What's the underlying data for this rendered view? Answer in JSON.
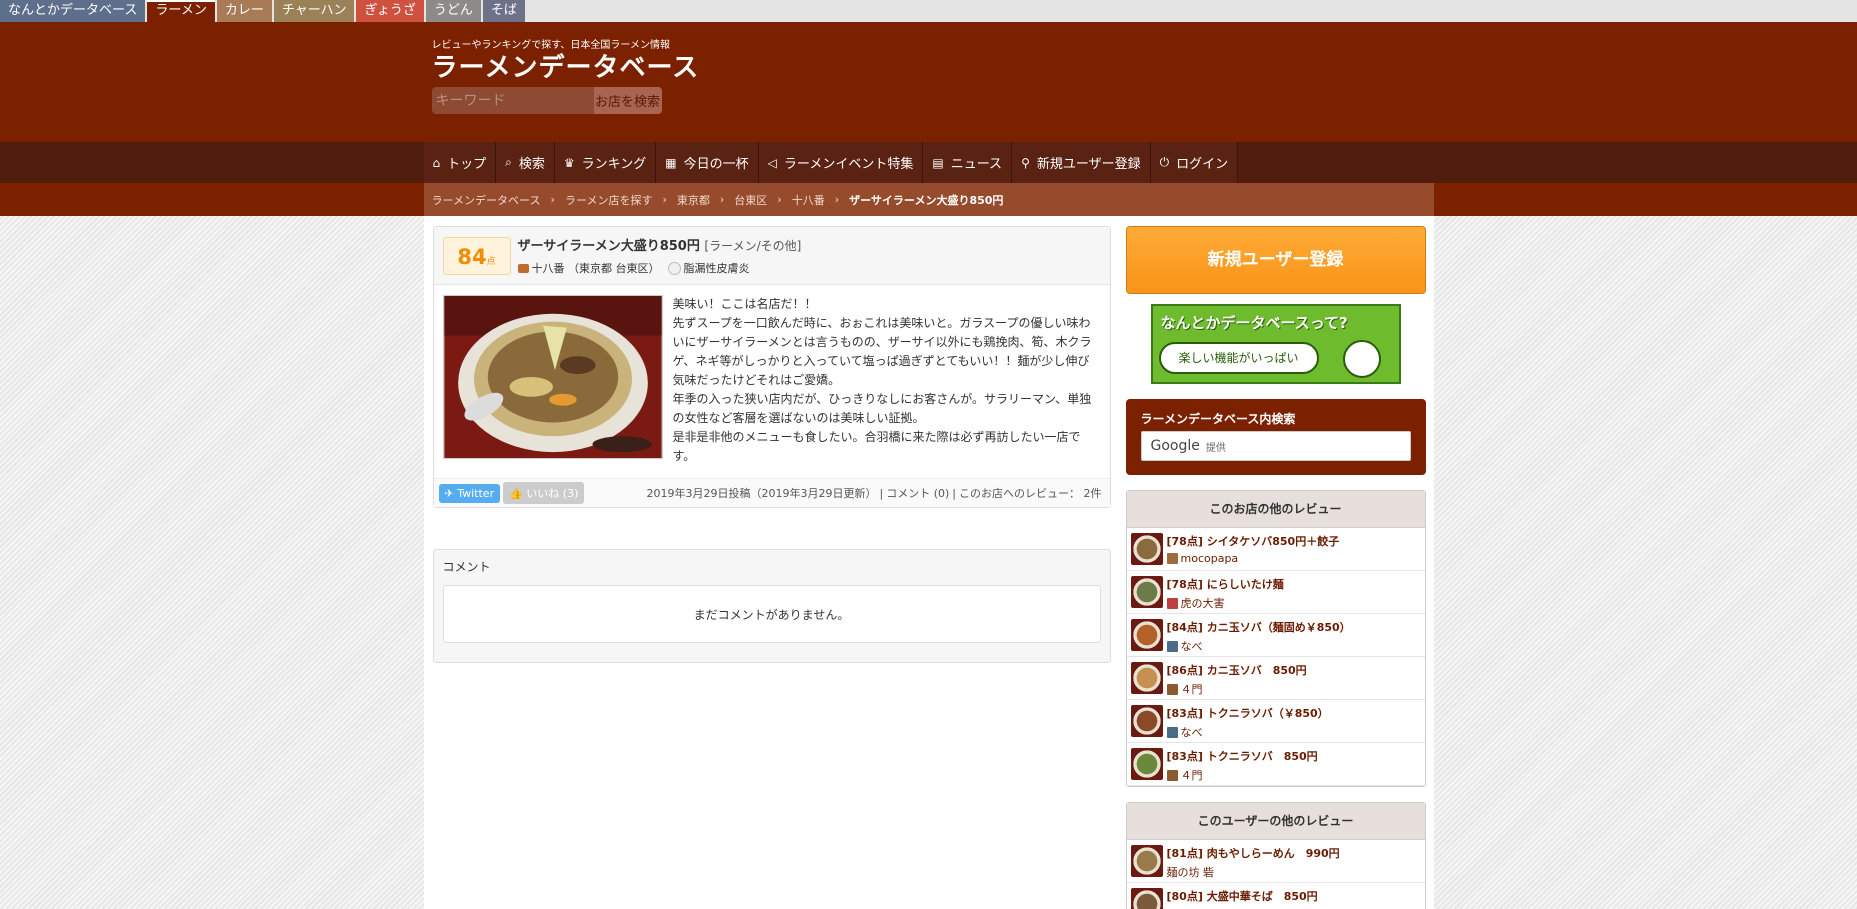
{
  "site_tabs": [
    {
      "label": "なんとかデータベース",
      "color": "#5e6f8c",
      "active": false
    },
    {
      "label": "ラーメン",
      "color": "#7b2100",
      "active": true
    },
    {
      "label": "カレー",
      "color": "#a87a56",
      "active": false
    },
    {
      "label": "チャーハン",
      "color": "#9a8158",
      "active": false
    },
    {
      "label": "ぎょうざ",
      "color": "#d0513f",
      "active": false
    },
    {
      "label": "うどん",
      "color": "#8e8a8a",
      "active": false
    },
    {
      "label": "そば",
      "color": "#6e7289",
      "active": false
    }
  ],
  "header": {
    "tagline": "レビューやランキングで探す、日本全国ラーメン情報",
    "logo": "ラーメンデータベース",
    "search_placeholder": "キーワード",
    "search_button": "お店を検索"
  },
  "nav": [
    {
      "icon": "home-icon",
      "glyph": "⌂",
      "label": "トップ"
    },
    {
      "icon": "search-icon",
      "glyph": "⌕",
      "label": "検索"
    },
    {
      "icon": "trophy-icon",
      "glyph": "♛",
      "label": "ランキング"
    },
    {
      "icon": "calendar-icon",
      "glyph": "▦",
      "label": "今日の一杯"
    },
    {
      "icon": "bullhorn-icon",
      "glyph": "◁",
      "label": "ラーメンイベント特集"
    },
    {
      "icon": "newspaper-icon",
      "glyph": "▤",
      "label": "ニュース"
    },
    {
      "icon": "user-plus-icon",
      "glyph": "⚲",
      "label": "新規ユーザー登録"
    },
    {
      "icon": "power-icon",
      "glyph": "⏻",
      "label": "ログイン"
    }
  ],
  "breadcrumb": {
    "items": [
      "ラーメンデータベース",
      "ラーメン店を探す",
      "東京都",
      "台東区",
      "十八番"
    ],
    "current": "ザーサイラーメン大盛り850円"
  },
  "review": {
    "score": "84",
    "score_unit": "点",
    "title": "ザーサイラーメン大盛り850円",
    "category": "[ラーメン/その他]",
    "shop": "十八番 （東京都 台東区）",
    "user": "脂漏性皮膚炎",
    "body": "美味い！ここは名店だ！！\n先ずスープを一口飲んだ時に、おぉこれは美味いと。ガラスープの優しい味わいにザーサイラーメンとは言うものの、ザーサイ以外にも鶏挽肉、筍、木クラゲ、ネギ等がしっかりと入っていて塩っぱ過ぎずとてもいい！！麺が少し伸び気味だったけどそれはご愛嬌。\n年季の入った狭い店内だが、ひっきりなしにお客さんが。サラリーマン、単独の女性など客層を選ばないのは美味しい証拠。\n是非是非他のメニューも食したい。合羽橋に来た際は必ず再訪したい一店です。",
    "twitter_label": "Twitter",
    "like_label": "いいね (3)",
    "posted": "2019年3月29日投稿（2019年3月29日更新）",
    "comment_count": "コメント (0)",
    "shop_reviews": "このお店へのレビュー： 2件"
  },
  "comments": {
    "title": "コメント",
    "empty": "まだコメントがありません。"
  },
  "sidebar": {
    "register_label": "新規ユーザー登録",
    "banner_title": "なんとかデータベースって?",
    "banner_bubble": "楽しい機能がいっぱい",
    "search_title": "ラーメンデータベース内検索",
    "google_logo": "Google",
    "google_provided": "提供",
    "shop_reviews_title": "このお店の他のレビュー",
    "shop_reviews": [
      {
        "title": "[78点] シイタケソバ850円＋餃子",
        "user": "mocopapa",
        "thumb": "#8a6a3e",
        "avatar": "#a06a40"
      },
      {
        "title": "[78点] にらしいたけ麺",
        "user": "虎の大害",
        "thumb": "#6d7a4a",
        "avatar": "#c04040"
      },
      {
        "title": "[84点] カニ玉ソバ（麺固め￥850）",
        "user": "なべ",
        "thumb": "#b5622a",
        "avatar": "#4a6b8a"
      },
      {
        "title": "[86点] カニ玉ソバ　850円",
        "user": "４門",
        "thumb": "#c89050",
        "avatar": "#8a5a30"
      },
      {
        "title": "[83点] トクニラソバ（￥850）",
        "user": "なべ",
        "thumb": "#8a4a2a",
        "avatar": "#4a6b8a"
      },
      {
        "title": "[83点] トクニラソバ　850円",
        "user": "４門",
        "thumb": "#6a8a3a",
        "avatar": "#8a5a30"
      }
    ],
    "user_reviews_title": "このユーザーの他のレビュー",
    "user_reviews": [
      {
        "title": "[81点] 肉もやしらーめん　990円",
        "user": "麺の坊 砦",
        "thumb": "#9a7a4a"
      },
      {
        "title": "[80点] 大盛中華そば　850円",
        "user": "",
        "thumb": "#7a5a3a"
      }
    ]
  }
}
